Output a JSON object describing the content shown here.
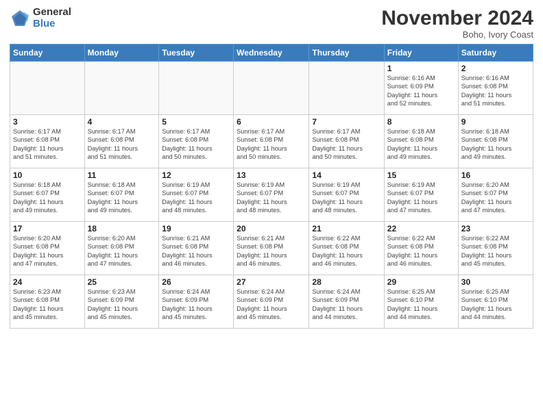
{
  "logo": {
    "general": "General",
    "blue": "Blue"
  },
  "title": "November 2024",
  "location": "Boho, Ivory Coast",
  "headers": [
    "Sunday",
    "Monday",
    "Tuesday",
    "Wednesday",
    "Thursday",
    "Friday",
    "Saturday"
  ],
  "weeks": [
    [
      {
        "day": "",
        "info": ""
      },
      {
        "day": "",
        "info": ""
      },
      {
        "day": "",
        "info": ""
      },
      {
        "day": "",
        "info": ""
      },
      {
        "day": "",
        "info": ""
      },
      {
        "day": "1",
        "info": "Sunrise: 6:16 AM\nSunset: 6:09 PM\nDaylight: 11 hours\nand 52 minutes."
      },
      {
        "day": "2",
        "info": "Sunrise: 6:16 AM\nSunset: 6:08 PM\nDaylight: 11 hours\nand 51 minutes."
      }
    ],
    [
      {
        "day": "3",
        "info": "Sunrise: 6:17 AM\nSunset: 6:08 PM\nDaylight: 11 hours\nand 51 minutes."
      },
      {
        "day": "4",
        "info": "Sunrise: 6:17 AM\nSunset: 6:08 PM\nDaylight: 11 hours\nand 51 minutes."
      },
      {
        "day": "5",
        "info": "Sunrise: 6:17 AM\nSunset: 6:08 PM\nDaylight: 11 hours\nand 50 minutes."
      },
      {
        "day": "6",
        "info": "Sunrise: 6:17 AM\nSunset: 6:08 PM\nDaylight: 11 hours\nand 50 minutes."
      },
      {
        "day": "7",
        "info": "Sunrise: 6:17 AM\nSunset: 6:08 PM\nDaylight: 11 hours\nand 50 minutes."
      },
      {
        "day": "8",
        "info": "Sunrise: 6:18 AM\nSunset: 6:08 PM\nDaylight: 11 hours\nand 49 minutes."
      },
      {
        "day": "9",
        "info": "Sunrise: 6:18 AM\nSunset: 6:08 PM\nDaylight: 11 hours\nand 49 minutes."
      }
    ],
    [
      {
        "day": "10",
        "info": "Sunrise: 6:18 AM\nSunset: 6:07 PM\nDaylight: 11 hours\nand 49 minutes."
      },
      {
        "day": "11",
        "info": "Sunrise: 6:18 AM\nSunset: 6:07 PM\nDaylight: 11 hours\nand 49 minutes."
      },
      {
        "day": "12",
        "info": "Sunrise: 6:19 AM\nSunset: 6:07 PM\nDaylight: 11 hours\nand 48 minutes."
      },
      {
        "day": "13",
        "info": "Sunrise: 6:19 AM\nSunset: 6:07 PM\nDaylight: 11 hours\nand 48 minutes."
      },
      {
        "day": "14",
        "info": "Sunrise: 6:19 AM\nSunset: 6:07 PM\nDaylight: 11 hours\nand 48 minutes."
      },
      {
        "day": "15",
        "info": "Sunrise: 6:19 AM\nSunset: 6:07 PM\nDaylight: 11 hours\nand 47 minutes."
      },
      {
        "day": "16",
        "info": "Sunrise: 6:20 AM\nSunset: 6:07 PM\nDaylight: 11 hours\nand 47 minutes."
      }
    ],
    [
      {
        "day": "17",
        "info": "Sunrise: 6:20 AM\nSunset: 6:08 PM\nDaylight: 11 hours\nand 47 minutes."
      },
      {
        "day": "18",
        "info": "Sunrise: 6:20 AM\nSunset: 6:08 PM\nDaylight: 11 hours\nand 47 minutes."
      },
      {
        "day": "19",
        "info": "Sunrise: 6:21 AM\nSunset: 6:08 PM\nDaylight: 11 hours\nand 46 minutes."
      },
      {
        "day": "20",
        "info": "Sunrise: 6:21 AM\nSunset: 6:08 PM\nDaylight: 11 hours\nand 46 minutes."
      },
      {
        "day": "21",
        "info": "Sunrise: 6:22 AM\nSunset: 6:08 PM\nDaylight: 11 hours\nand 46 minutes."
      },
      {
        "day": "22",
        "info": "Sunrise: 6:22 AM\nSunset: 6:08 PM\nDaylight: 11 hours\nand 46 minutes."
      },
      {
        "day": "23",
        "info": "Sunrise: 6:22 AM\nSunset: 6:08 PM\nDaylight: 11 hours\nand 45 minutes."
      }
    ],
    [
      {
        "day": "24",
        "info": "Sunrise: 6:23 AM\nSunset: 6:08 PM\nDaylight: 11 hours\nand 45 minutes."
      },
      {
        "day": "25",
        "info": "Sunrise: 6:23 AM\nSunset: 6:09 PM\nDaylight: 11 hours\nand 45 minutes."
      },
      {
        "day": "26",
        "info": "Sunrise: 6:24 AM\nSunset: 6:09 PM\nDaylight: 11 hours\nand 45 minutes."
      },
      {
        "day": "27",
        "info": "Sunrise: 6:24 AM\nSunset: 6:09 PM\nDaylight: 11 hours\nand 45 minutes."
      },
      {
        "day": "28",
        "info": "Sunrise: 6:24 AM\nSunset: 6:09 PM\nDaylight: 11 hours\nand 44 minutes."
      },
      {
        "day": "29",
        "info": "Sunrise: 6:25 AM\nSunset: 6:10 PM\nDaylight: 11 hours\nand 44 minutes."
      },
      {
        "day": "30",
        "info": "Sunrise: 6:25 AM\nSunset: 6:10 PM\nDaylight: 11 hours\nand 44 minutes."
      }
    ]
  ]
}
